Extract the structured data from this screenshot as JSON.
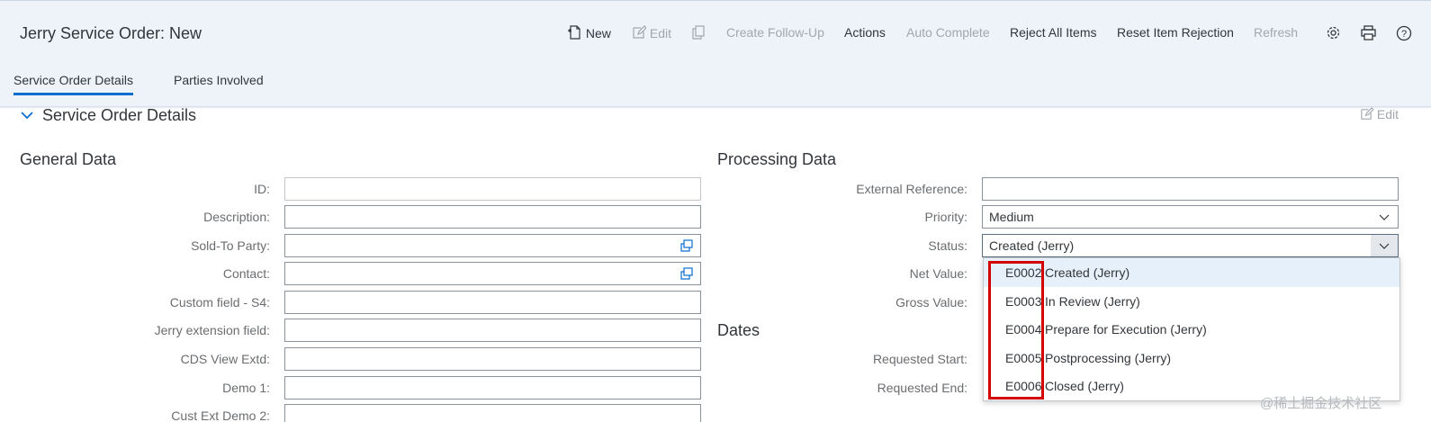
{
  "header": {
    "title": "Jerry Service Order: New",
    "toolbar": {
      "new": "New",
      "edit": "Edit",
      "create_follow_up": "Create Follow-Up",
      "actions": "Actions",
      "auto_complete": "Auto Complete",
      "reject_all_items": "Reject All Items",
      "reset_item_rejection": "Reset Item Rejection",
      "refresh": "Refresh"
    },
    "icons": [
      "new-document-icon",
      "edit-pencil-icon",
      "copy-icon",
      "settings-gear-icon",
      "print-icon",
      "help-icon"
    ],
    "tabs": [
      {
        "label": "Service Order Details",
        "active": true
      },
      {
        "label": "Parties Involved",
        "active": false
      }
    ]
  },
  "section": {
    "title": "Service Order Details",
    "edit_label": "Edit"
  },
  "general_data": {
    "title": "General Data",
    "fields": [
      {
        "label": "ID:",
        "value": ""
      },
      {
        "label": "Description:",
        "value": ""
      },
      {
        "label": "Sold-To Party:",
        "value": ""
      },
      {
        "label": "Contact:",
        "value": ""
      },
      {
        "label": "Custom field - S4:",
        "value": ""
      },
      {
        "label": "Jerry extension field:",
        "value": ""
      },
      {
        "label": "CDS View Extd:",
        "value": ""
      },
      {
        "label": "Demo 1:",
        "value": ""
      },
      {
        "label": "Cust Ext Demo 2:",
        "value": ""
      }
    ]
  },
  "processing_data": {
    "title": "Processing Data",
    "fields": [
      {
        "label": "External Reference:",
        "value": ""
      },
      {
        "label": "Priority:",
        "value": "Medium"
      },
      {
        "label": "Status:",
        "value": "Created (Jerry)"
      },
      {
        "label": "Net Value:",
        "value": ""
      },
      {
        "label": "Gross Value:",
        "value": ""
      }
    ]
  },
  "dates": {
    "title": "Dates",
    "fields": [
      {
        "label": "Requested Start:",
        "value": ""
      },
      {
        "label": "Requested End:",
        "value": ""
      }
    ]
  },
  "status_dropdown": {
    "options": [
      {
        "key": "E0002",
        "text": "Created (Jerry)",
        "selected": true
      },
      {
        "key": "E0003",
        "text": "In Review (Jerry)",
        "selected": false
      },
      {
        "key": "E0004",
        "text": "Prepare for Execution (Jerry)",
        "selected": false
      },
      {
        "key": "E0005",
        "text": "Postprocessing (Jerry)",
        "selected": false
      },
      {
        "key": "E0006",
        "text": "Closed (Jerry)",
        "selected": false
      }
    ]
  },
  "colors": {
    "header_bg": "#edf3f9",
    "accent": "#0a6ed1",
    "highlight_box": "#d40000",
    "selected_option": "#e5f0fa"
  },
  "watermark": "@稀土掘金技术社区"
}
